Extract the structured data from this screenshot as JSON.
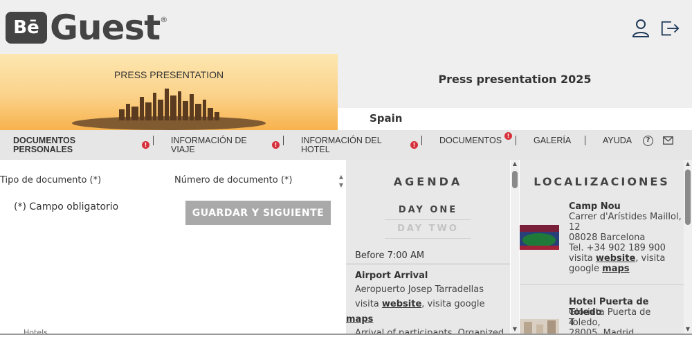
{
  "brand": {
    "logo_mark": "Bē",
    "logo_text": "Guest",
    "registered": "®"
  },
  "header": {
    "icons": [
      "user-icon",
      "logout-icon"
    ]
  },
  "banner": {
    "title": "PRESS PRESENTATION"
  },
  "event": {
    "title": "Press presentation 2025",
    "country": "Spain"
  },
  "nav": {
    "items": [
      {
        "label_1": "DOCUMENTOS",
        "label_2": "PERSONALES",
        "alert": "!"
      },
      {
        "label_1": "INFORMACIÓN DE",
        "label_2": "VIAJE",
        "alert": "!"
      },
      {
        "label_1": "INFORMACIÓN DEL",
        "label_2": "HOTEL",
        "alert": "!"
      },
      {
        "label_1": "DOCUMENTOS",
        "alert": "!"
      },
      {
        "label_1": "GALERÍA"
      },
      {
        "label_1": "AYUDA"
      }
    ],
    "help_icon": "?"
  },
  "form": {
    "doc_type_label": "Tipo de documento (*)",
    "doc_number_label": "Número de documento (*)",
    "required_note": "(*) Campo obligatorio",
    "submit_label": "GUARDAR Y SIGUIENTE",
    "stray_text": "Hotels"
  },
  "agenda": {
    "title": "AGENDA",
    "days": [
      "DAY ONE",
      "DAY TWO"
    ],
    "time": "Before 7:00 AM",
    "item_title": "Airport Arrival",
    "item_place": "Aeropuerto Josep Tarradellas",
    "visit_text": "visita",
    "website_label": "website",
    "google_text": ", visita google",
    "maps_label": "maps",
    "item_desc": "Arrival of participants. Organized"
  },
  "locations": {
    "title": "LOCALIZACIONES",
    "items": [
      {
        "name": "Camp Nou",
        "address_1": "Carrer d'Arístides Maillol,",
        "address_2": "12",
        "city": "08028 Barcelona",
        "phone": "Tel. +34 902 189 900",
        "visit_text": "visita",
        "website_label": "website",
        "google_text": ", visita",
        "google_text_2": "google",
        "maps_label": "maps"
      },
      {
        "name": "Hotel Puerta de Toledo",
        "address_1": "Glorieta Puerta de Toledo,",
        "address_2": "4",
        "city": "28005, Madrid"
      }
    ]
  }
}
